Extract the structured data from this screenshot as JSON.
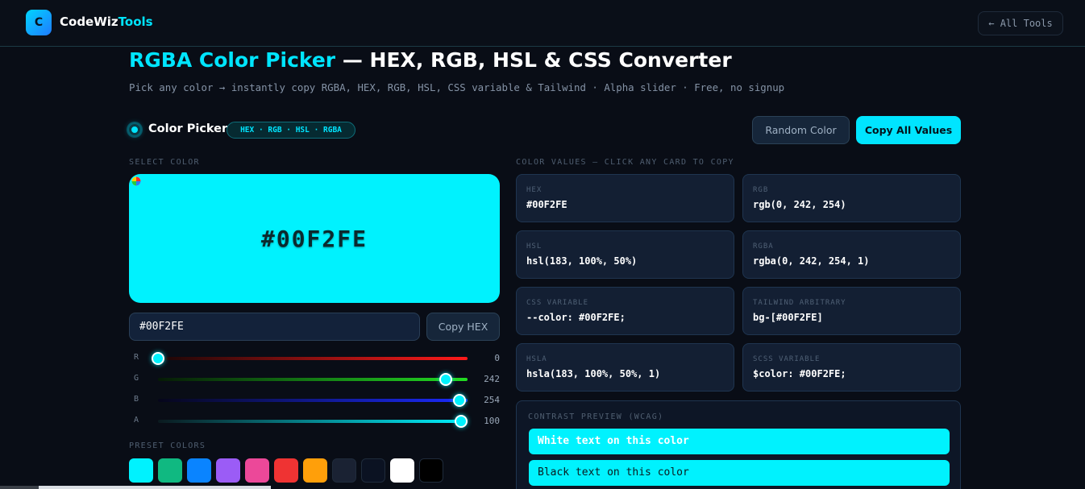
{
  "header": {
    "logo_letter": "C",
    "brand_primary": "CodeWiz",
    "brand_accent": "Tools",
    "all_tools_label": "← All Tools"
  },
  "title": {
    "accent": "RGBA Color Picker",
    "rest": " — HEX, RGB, HSL & CSS Converter",
    "subtitle": "Pick any color → instantly copy RGBA, HEX, RGB, HSL, CSS variable & Tailwind · Alpha slider · Free, no signup"
  },
  "toolbar": {
    "tool_name": "Color Picker",
    "formats_pill": "HEX · RGB · HSL · RGBA",
    "random_label": "Random Color",
    "copy_all_label": "Copy All Values"
  },
  "picker": {
    "section_label": "SELECT COLOR",
    "preview_hex": "#00F2FE",
    "preview_color": "#00f2fe",
    "hex_input_value": "#00F2FE",
    "copy_hex_label": "Copy HEX",
    "sliders": [
      {
        "letter": "R",
        "value": "0",
        "fraction": 0.0,
        "gradient": "linear-gradient(90deg,#1a0606,#ff1a1a)"
      },
      {
        "letter": "G",
        "value": "242",
        "fraction": 0.949,
        "gradient": "linear-gradient(90deg,#061a06,#22dd22)"
      },
      {
        "letter": "B",
        "value": "254",
        "fraction": 0.996,
        "gradient": "linear-gradient(90deg,#06061a,#1a2aff)"
      },
      {
        "letter": "A",
        "value": "100",
        "fraction": 1.0,
        "gradient": "linear-gradient(90deg,#0b1a1f,#00f2fe)"
      }
    ],
    "preset_label": "PRESET COLORS",
    "presets": [
      "#00f2fe",
      "#10b981",
      "#0a84ff",
      "#9b5cf6",
      "#ec4899",
      "#ef3333",
      "#ff9f0a",
      "#1a2233",
      "#0b1222",
      "#ffffff",
      "#000000"
    ]
  },
  "values": {
    "section_label": "COLOR VALUES — CLICK ANY CARD TO COPY",
    "cards": [
      {
        "label": "HEX",
        "value": "#00F2FE"
      },
      {
        "label": "RGB",
        "value": "rgb(0, 242, 254)"
      },
      {
        "label": "HSL",
        "value": "hsl(183, 100%, 50%)"
      },
      {
        "label": "RGBA",
        "value": "rgba(0, 242, 254, 1)"
      },
      {
        "label": "CSS VARIABLE",
        "value": "--color: #00F2FE;"
      },
      {
        "label": "TAILWIND ARBITRARY",
        "value": "bg-[#00F2FE]"
      },
      {
        "label": "HSLA",
        "value": "hsla(183, 100%, 50%, 1)"
      },
      {
        "label": "SCSS VARIABLE",
        "value": "$color: #00F2FE;"
      }
    ]
  },
  "contrast": {
    "label": "CONTRAST PREVIEW (WCAG)",
    "white_text": "White text on this color",
    "black_text": "Black text on this color"
  },
  "colors": {
    "accent": "#00e5ff",
    "background": "#090d16",
    "card": "#131f33"
  }
}
